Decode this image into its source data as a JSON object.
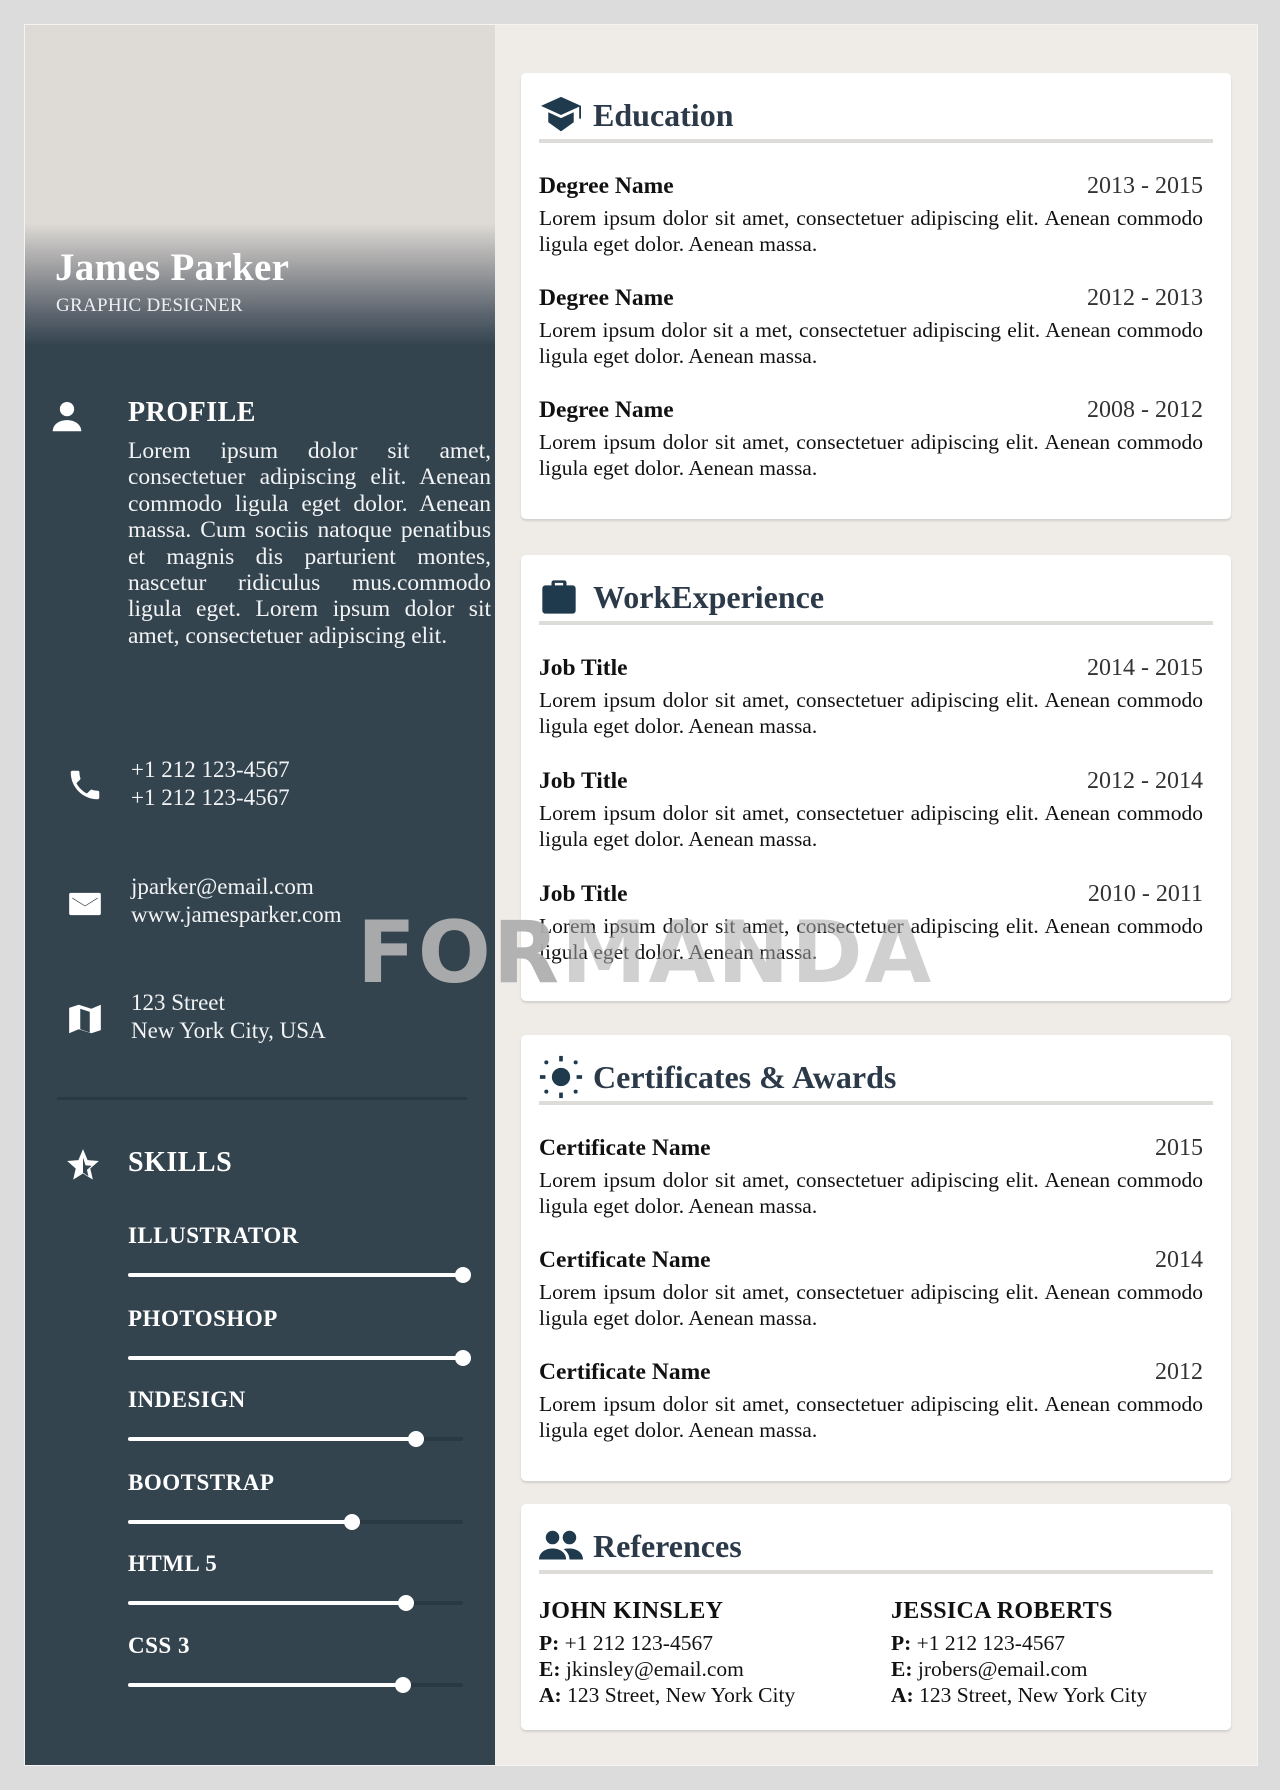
{
  "header": {
    "name": "James Parker",
    "role": "GRAPHIC DESIGNER"
  },
  "sidebar": {
    "profile": {
      "title": "PROFILE",
      "icon": "person-icon",
      "text": "Lorem ipsum dolor sit amet, consectetuer adipiscing elit. Aenean commodo ligula eget dolor. Aenean massa. Cum sociis natoque penatibus et magnis dis parturient montes, nascetur ridiculus mus.commodo ligula eget. Lorem ipsum dolor sit amet, consectetuer adipiscing elit."
    },
    "contact": {
      "phone": {
        "icon": "phone-icon",
        "lines": [
          "+1 212 123-4567",
          "+1 212 123-4567"
        ]
      },
      "web": {
        "icon": "mail-icon",
        "lines": [
          "jparker@email.com",
          "www.jamesparker.com"
        ]
      },
      "address": {
        "icon": "map-icon",
        "lines": [
          "123 Street",
          "New York City, USA"
        ]
      }
    },
    "skills": {
      "title": "SKILLS",
      "icon": "star-icon",
      "items": [
        {
          "label": "ILLUSTRATOR",
          "level": 1.0
        },
        {
          "label": "PHOTOSHOP",
          "level": 1.0
        },
        {
          "label": "INDESIGN",
          "level": 0.86
        },
        {
          "label": "BOOTSTRAP",
          "level": 0.67
        },
        {
          "label": "HTML 5",
          "level": 0.83
        },
        {
          "label": "CSS 3",
          "level": 0.82
        }
      ]
    }
  },
  "education": {
    "title": "Education",
    "icon": "graduation-cap-icon",
    "entries": [
      {
        "name": "Degree Name",
        "date": "2013 - 2015",
        "desc": "Lorem ipsum dolor sit amet, consectetuer adipiscing elit. Aenean commodo ligula eget dolor. Aenean massa."
      },
      {
        "name": "Degree Name",
        "date": "2012 - 2013",
        "desc": "Lorem ipsum dolor sit a met, consectetuer adipiscing elit. Aenean commodo ligula eget dolor. Aenean massa."
      },
      {
        "name": "Degree Name",
        "date": "2008 - 2012",
        "desc": "Lorem ipsum dolor sit amet, consectetuer adipiscing elit. Aenean commodo ligula eget dolor. Aenean massa."
      }
    ]
  },
  "work": {
    "title": "WorkExperience",
    "icon": "briefcase-icon",
    "entries": [
      {
        "name": "Job Title",
        "date": "2014 - 2015",
        "desc": "Lorem ipsum dolor sit amet, consectetuer adipiscing elit. Aenean commodo ligula eget dolor. Aenean massa."
      },
      {
        "name": "Job Title",
        "date": "2012 - 2014",
        "desc": "Lorem ipsum dolor sit amet, consectetuer adipiscing elit. Aenean commodo ligula eget dolor. Aenean massa."
      },
      {
        "name": "Job Title",
        "date": "2010 - 2011",
        "desc": "Lorem ipsum dolor sit amet, consectetuer adipiscing elit. Aenean commodo ligula eget dolor. Aenean massa."
      }
    ]
  },
  "certificates": {
    "title": "Certificates & Awards",
    "icon": "sun-icon",
    "entries": [
      {
        "name": "Certificate Name",
        "date": "2015",
        "desc": "Lorem ipsum dolor sit amet, consectetuer adipiscing elit. Aenean commodo ligula eget dolor. Aenean massa."
      },
      {
        "name": "Certificate Name",
        "date": "2014",
        "desc": "Lorem ipsum dolor sit amet, consectetuer adipiscing elit. Aenean commodo ligula eget dolor. Aenean massa."
      },
      {
        "name": "Certificate Name",
        "date": "2012",
        "desc": "Lorem ipsum dolor sit amet, consectetuer adipiscing elit. Aenean commodo ligula eget dolor. Aenean massa."
      }
    ]
  },
  "references": {
    "title": "References",
    "icon": "people-icon",
    "labels": {
      "phone": "P:",
      "email": "E:",
      "address": "A:"
    },
    "people": [
      {
        "name": "JOHN KINSLEY",
        "phone": "+1 212 123-4567",
        "email": "jkinsley@email.com",
        "address": "123 Street, New York City"
      },
      {
        "name": "JESSICA ROBERTS",
        "phone": "+1 212 123-4567",
        "email": "jrobers@email.com",
        "address": "123 Street, New York City"
      }
    ]
  },
  "watermark": {
    "part1": "FOR",
    "part2": "MANDA"
  },
  "colors": {
    "sidebar": "#34444f",
    "accent_icon": "#1f3a4d",
    "heading": "#2b3949",
    "page_bg": "#efece8",
    "card_bg": "#ffffff",
    "rule": "#dedcd8"
  }
}
